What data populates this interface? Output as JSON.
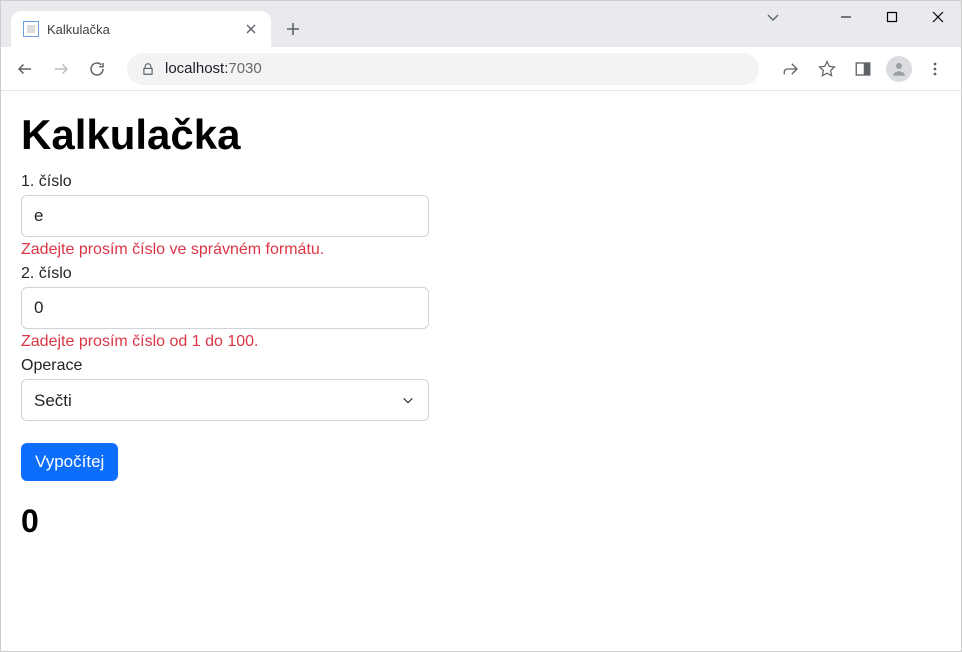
{
  "browser": {
    "tab_title": "Kalkulačka",
    "url_host": "localhost:",
    "url_port": "7030"
  },
  "page": {
    "heading": "Kalkulačka",
    "field1_label": "1. číslo",
    "field1_value": "e",
    "field1_error": "Zadejte prosím číslo ve správném formátu.",
    "field2_label": "2. číslo",
    "field2_value": "0",
    "field2_error": "Zadejte prosím číslo od 1 do 100.",
    "operation_label": "Operace",
    "operation_value": "Sečti",
    "submit_label": "Vypočítej",
    "result": "0"
  }
}
